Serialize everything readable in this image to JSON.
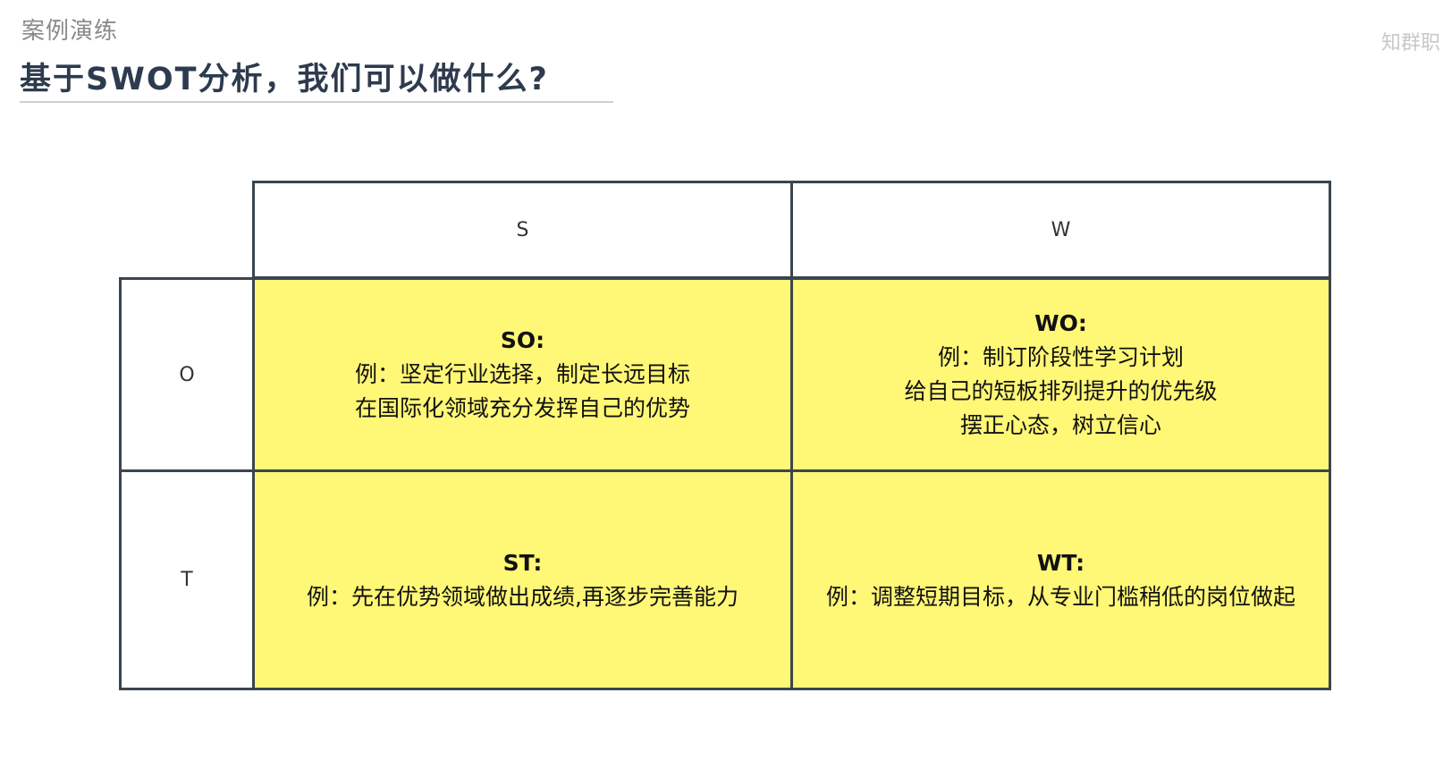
{
  "header": {
    "section_label": "案例演练",
    "title": "基于SWOT分析，我们可以做什么?",
    "watermark": "知群职"
  },
  "matrix": {
    "columns": [
      "S",
      "W"
    ],
    "rows": [
      "O",
      "T"
    ],
    "accent_color": "#fff776",
    "border_color": "#3b4550",
    "cells": {
      "so": {
        "title": "SO:",
        "lines": [
          "例：坚定行业选择，制定长远目标",
          "在国际化领域充分发挥自己的优势"
        ]
      },
      "wo": {
        "title": "WO:",
        "lines": [
          "例：制订阶段性学习计划",
          "给自己的短板排列提升的优先级",
          "摆正心态，树立信心"
        ]
      },
      "st": {
        "title": "ST:",
        "lines": [
          "例：先在优势领域做出成绩,再逐步完善能力"
        ]
      },
      "wt": {
        "title": "WT:",
        "lines": [
          "例：调整短期目标，从专业门槛稍低的岗位做起"
        ]
      }
    }
  }
}
